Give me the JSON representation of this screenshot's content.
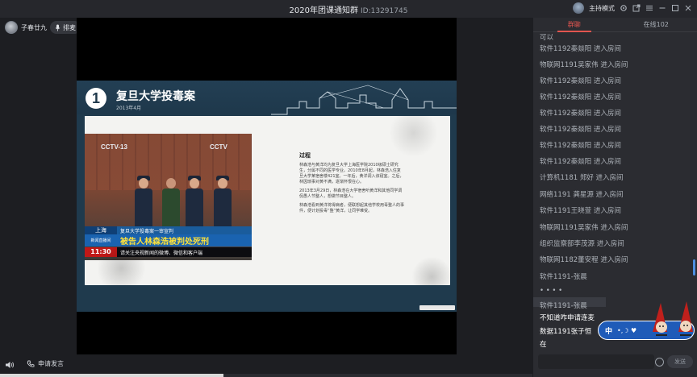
{
  "window": {
    "title": "2020年团课通知群",
    "room_id": "ID:13291745",
    "host_mode": "主持模式"
  },
  "user": {
    "name": "子春廿九",
    "queue_label": "排麦"
  },
  "slide": {
    "number": "1",
    "title": "复旦大学投毒案",
    "date": "2013年4月",
    "news": {
      "channel": "CCTV-13",
      "location": "上海",
      "case_line": "复旦大学投毒案一审宣判",
      "tag": "新闻直播间",
      "headline": "被告人林森浩被判处死刑",
      "time": "11:30",
      "ticker": "请关注央视新闻的微博、微信和客户端"
    },
    "process_title": "过程",
    "paragraphs": [
      "林森浩与黄洋均为复旦大学上海医学院2010级硕士研究生，分属不同的医学专业。2010年8月起，林森浩入住复旦大学某宿舍楼421室。一年后，黄洋调入该寝室。之后，林因琐事对黄不满，逐渐怀恨在心。",
      "2013年3月29日，林森浩在大学宿舍听黄洋和其他同学调侃愚人节整人，想做节目整人。",
      "林森浩看到黄洋将得病者，便联想起其他学校用毒整人的事件，便计划投毒“整”黄洋，让同学难受。"
    ]
  },
  "controls": {
    "apply_speak": "申请发言",
    "progress": 0.42
  },
  "panel": {
    "tabs": [
      {
        "label": "群聊",
        "active": true
      },
      {
        "label": "在线102",
        "active": false
      }
    ],
    "messages": [
      "可以",
      "软件1192秦燚阳 进入房间",
      "物联网1191吴家伟 进入房间",
      "软件1192秦燚阳 进入房间",
      "软件1192秦燚阳 进入房间",
      "软件1192秦燚阳 进入房间",
      "软件1192秦燚阳 进入房间",
      "软件1192秦燚阳 进入房间",
      "软件1192秦燚阳 进入房间",
      "计算机1181 郑好 进入房间",
      "网络1191 龚星源 进入房间",
      "软件1191王晓萱 进入房间",
      "物联网1191吴家伟 进入房间",
      "组织监察部李茂源 进入房间",
      "物联网1182董安程 进入房间",
      "软件1191-张晨",
      "• • • •",
      "软件1191-张晨",
      "不知道咋申请连麦",
      "数据1191张子恒",
      "在"
    ],
    "send_label": "发送"
  },
  "ime": {
    "mode": "中",
    "symbols": "•,☽ ♥"
  },
  "colors": {
    "accent": "#e2554f",
    "ime_blue": "#1f5bb8",
    "slide_bg": "#1f3a4d"
  }
}
